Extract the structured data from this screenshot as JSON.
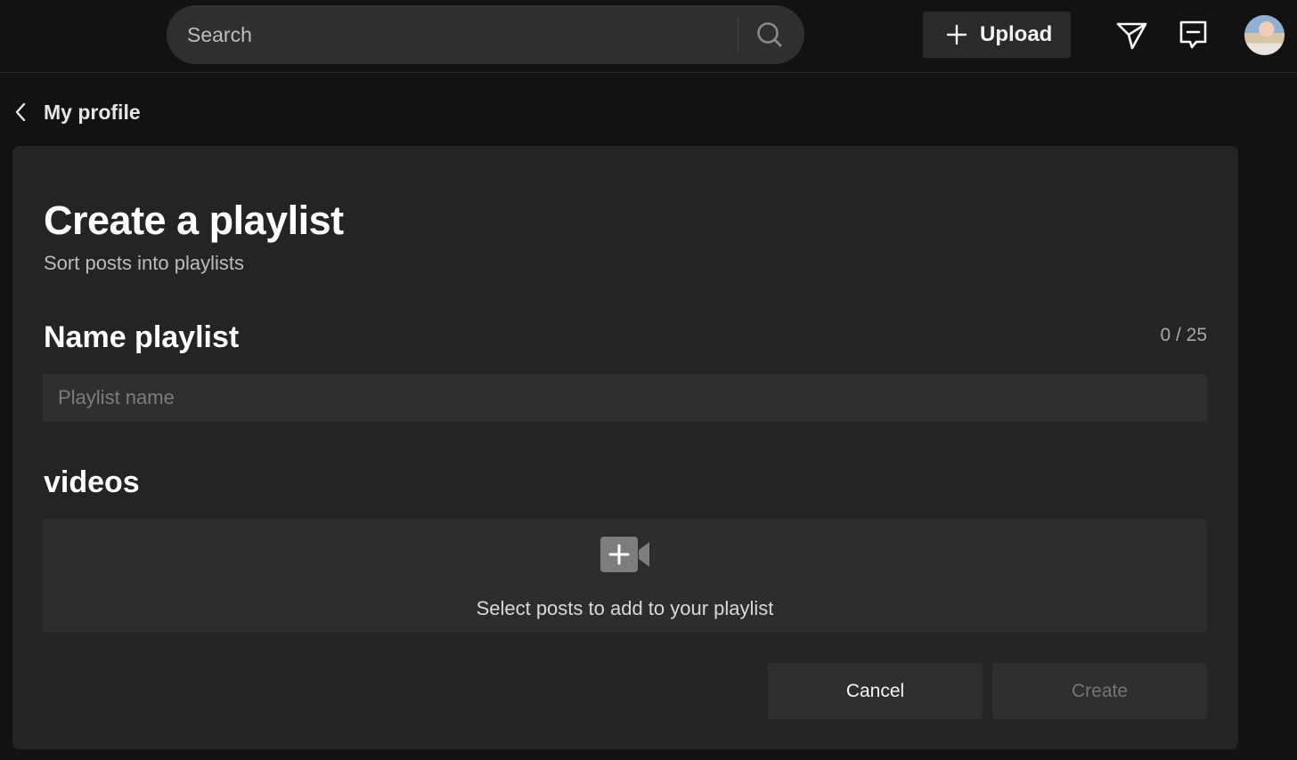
{
  "header": {
    "search": {
      "placeholder": "Search"
    },
    "upload_label": "Upload",
    "icons": [
      "search-icon",
      "plus-icon",
      "send-icon",
      "inbox-icon",
      "avatar"
    ]
  },
  "nav": {
    "back_label": "My profile"
  },
  "form": {
    "title": "Create a playlist",
    "subtitle": "Sort posts into playlists",
    "name_label": "Name playlist",
    "counter": "0 / 25",
    "name_placeholder": "Playlist name",
    "name_value": "",
    "videos_label": "videos",
    "videos_prompt": "Select posts to add to your playlist",
    "cancel_label": "Cancel",
    "create_label": "Create"
  },
  "colors": {
    "page_bg": "#121212",
    "card_bg": "#242424",
    "field_bg": "#2f2f2f",
    "disabled_text": "#757575"
  }
}
